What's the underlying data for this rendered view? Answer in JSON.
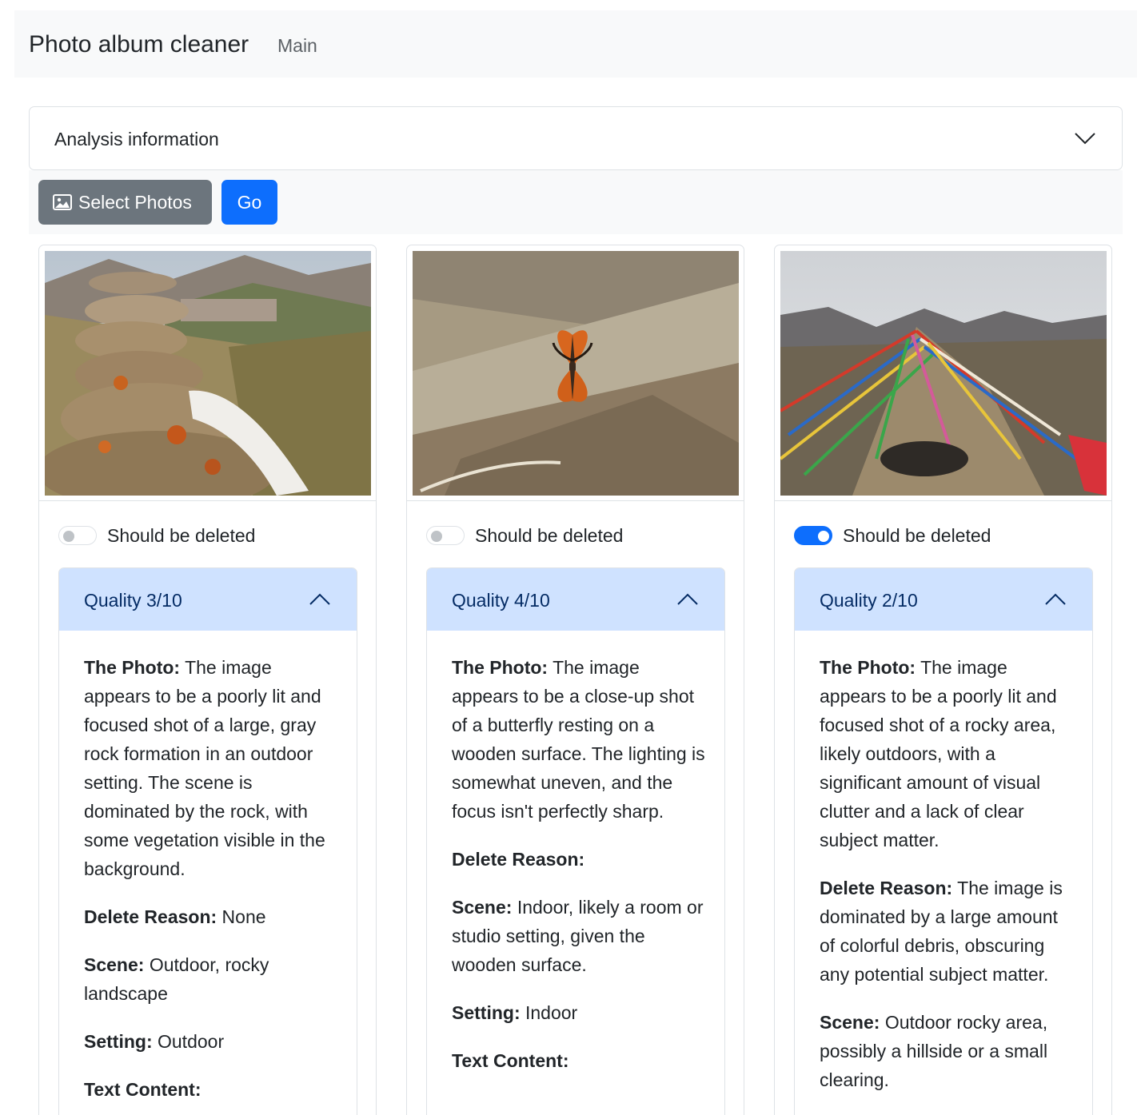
{
  "navbar": {
    "brand": "Photo album cleaner",
    "link": "Main"
  },
  "analysis": {
    "title": "Analysis information",
    "icon": "chevron-down-icon"
  },
  "toolbar": {
    "select_label": "Select Photos",
    "select_icon": "image-icon",
    "go_label": "Go"
  },
  "colors": {
    "primary": "#0d6efd",
    "secondary": "#6c757d",
    "accordion_active": "#cfe2ff"
  },
  "cards": [
    {
      "photo": "rock cairn on hillside above monastery",
      "delete_label": "Should be deleted",
      "delete_checked": false,
      "quality": "Quality 3/10",
      "photo_label": "The Photo:",
      "photo_text": " The image appears to be a poorly lit and focused shot of a large, gray rock formation in an outdoor setting. The scene is dominated by the rock, with some vegetation visible in the background.",
      "reason_label": "Delete Reason:",
      "reason_text": " None",
      "scene_label": "Scene:",
      "scene_text": " Outdoor, rocky landscape",
      "setting_label": "Setting:",
      "setting_text": " Outdoor",
      "text_label": "Text Content:"
    },
    {
      "photo": "orange butterfly resting on rock",
      "delete_label": "Should be deleted",
      "delete_checked": false,
      "quality": "Quality 4/10",
      "photo_label": "The Photo:",
      "photo_text": " The image appears to be a close-up shot of a butterfly resting on a wooden surface. The lighting is somewhat uneven, and the focus isn't perfectly sharp.",
      "reason_label": "Delete Reason:",
      "reason_text": "",
      "scene_label": "Scene:",
      "scene_text": " Indoor, likely a room or studio setting, given the wooden surface.",
      "setting_label": "Setting:",
      "setting_text": " Indoor",
      "text_label": "Text Content:"
    },
    {
      "photo": "prayer flags on mountain ridge",
      "delete_label": "Should be deleted",
      "delete_checked": true,
      "quality": "Quality 2/10",
      "photo_label": "The Photo:",
      "photo_text": " The image appears to be a poorly lit and focused shot of a rocky area, likely outdoors, with a significant amount of visual clutter and a lack of clear subject matter.",
      "reason_label": "Delete Reason:",
      "reason_text": " The image is dominated by a large amount of colorful debris, obscuring any potential subject matter.",
      "scene_label": "Scene:",
      "scene_text": " Outdoor rocky area, possibly a hillside or a small clearing."
    }
  ]
}
